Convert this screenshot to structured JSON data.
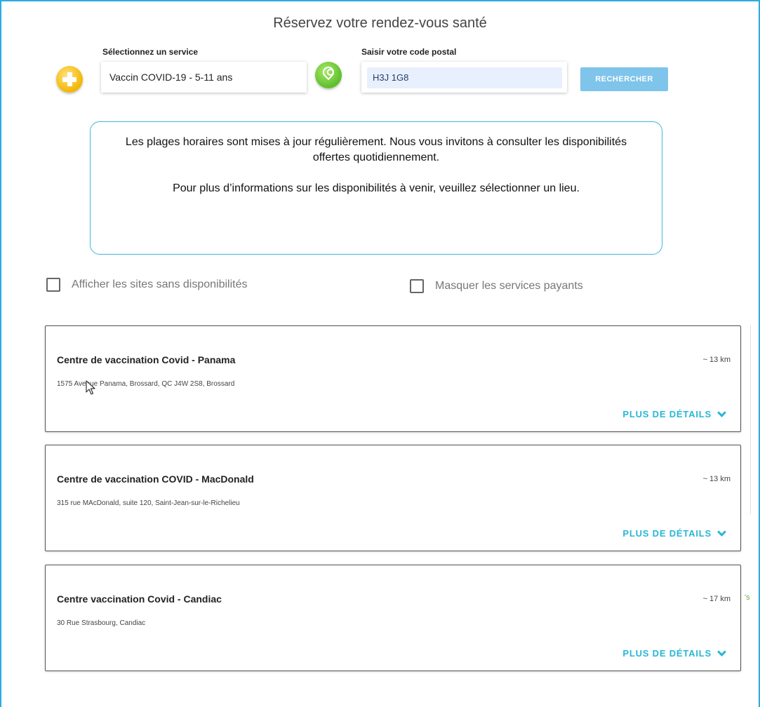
{
  "header": {
    "title": "Réservez votre rendez-vous santé"
  },
  "search": {
    "service_label": "Sélectionnez un service",
    "service_value": "Vaccin COVID-19 - 5-11 ans",
    "postal_label": "Saisir votre code postal",
    "postal_value": "H3J 1G8",
    "search_button": "RECHERCHER",
    "service_icon": "plus-icon",
    "postal_icon": "location-pin-icon"
  },
  "info": {
    "paragraph1": "Les plages horaires sont mises à jour régulièrement. Nous vous invitons à consulter les disponibilités offertes quotidiennement.",
    "paragraph2": "Pour plus d’informations sur les disponibilités à venir, veuillez sélectionner un lieu."
  },
  "filters": {
    "show_unavailable": "Afficher les sites sans disponibilités",
    "hide_paid": "Masquer les services payants"
  },
  "results": [
    {
      "name": "Centre de vaccination Covid - Panama",
      "address": "1575 Avenue Panama, Brossard, QC J4W 2S8, Brossard",
      "distance": "~ 13 km",
      "details": "PLUS DE DÉTAILS"
    },
    {
      "name": "Centre de vaccination COVID - MacDonald",
      "address": "315 rue MAcDonald, suite 120, Saint-Jean-sur-le-Richelieu",
      "distance": "~ 13 km",
      "details": "PLUS DE DÉTAILS"
    },
    {
      "name": "Centre vaccination Covid - Candiac",
      "address": "30 Rue Strasbourg, Candiac",
      "distance": "~ 17 km",
      "details": "PLUS DE DÉTAILS"
    }
  ],
  "side_fragment": "'s",
  "colors": {
    "accent": "#29abe2",
    "link": "#29b6d6",
    "button": "#7fc4ea",
    "plus_icon": "#f2b705",
    "pin_icon": "#5cbf2a"
  }
}
